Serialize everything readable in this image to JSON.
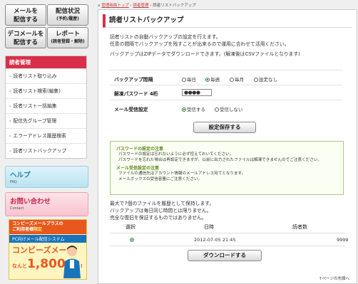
{
  "top_buttons": [
    {
      "label": "メールを",
      "sub": "配信する"
    },
    {
      "label": "配信状況",
      "sub": "(予約/履歴)"
    },
    {
      "label": "デコメールを",
      "sub": "配信する"
    },
    {
      "label": "レポート",
      "sub": "(読者登録・解除)"
    }
  ],
  "sidebar": {
    "heading": "読者管理",
    "items": [
      {
        "label": "読者リスト取り込み"
      },
      {
        "label": "読者リスト検索(編集)"
      },
      {
        "label": "読者リスト一括編集"
      },
      {
        "label": "配信先グループ管理"
      },
      {
        "label": "エラーアドレス履歴検索"
      },
      {
        "label": "読者リストバックアップ"
      }
    ]
  },
  "help": {
    "title": "ヘルプ",
    "sub": "FAQ"
  },
  "contact": {
    "title": "お問い合わせ",
    "sub": "Contact"
  },
  "ad": {
    "line1": "コンビーズメールプラスの",
    "line2a": "ご利用者様",
    "line2b": "限定",
    "line3": "PC向けメール配信システム",
    "brand": "コンビーズメール",
    "prefix": "なんと",
    "price": "1,800",
    "suffix": "円から!"
  },
  "breadcrumb": {
    "home": "管理画面トップ",
    "section": "読者管理",
    "current": "読者リストバックアップ",
    "sep": "›"
  },
  "page": {
    "title": "読者リストバックアップ",
    "intro": [
      "読者リストの自動バックアップの設定を行えます。",
      "任意の間隔でバックアップを残すことが出来るので運用に合わせて活用ください。",
      "バックアップはZIPデータでダウンロードできます。(解凍後はCSVファイルとなります)"
    ],
    "interval_label": "バックアップ間隔",
    "interval_options": [
      "毎日",
      "毎週",
      "毎月",
      "設定なし"
    ],
    "interval_selected": 1,
    "password_label": "解凍パスワード 4桁",
    "password_value": "●●●●",
    "notify_label": "メール受信設定",
    "notify_options": [
      "受信する",
      "受信しない"
    ],
    "notify_selected": 0,
    "save_button": "設定保存する",
    "notes": {
      "h1": "パスワードの設定の注意",
      "l1": "パスワードの設定は忘れないように必ず控えておいてください。",
      "l2": "パスワードを忘れた場合は再設定できますが、以前に出力されたファイルは解凍できませんのでご注意ください。",
      "h2": "メール受信設定の注意",
      "l3": "ファイルの通信先はアカウント情報のメールアドレス宛てとなります。",
      "l4": "メールボックスの受信容量にご注意ください。"
    },
    "info": [
      "最大で7個のファイルを履歴として保持します。",
      "バックアップは毎日同じ時間とは限りません。",
      "完全な復旧を保証するものではありません。"
    ],
    "table": {
      "headers": [
        "選択",
        "日時",
        "読者数"
      ],
      "rows": [
        {
          "date": "2012-07-05 21:45",
          "count": "9999"
        }
      ]
    },
    "download_button": "ダウンロードする",
    "page_top": "↑ページの先頭へ"
  }
}
